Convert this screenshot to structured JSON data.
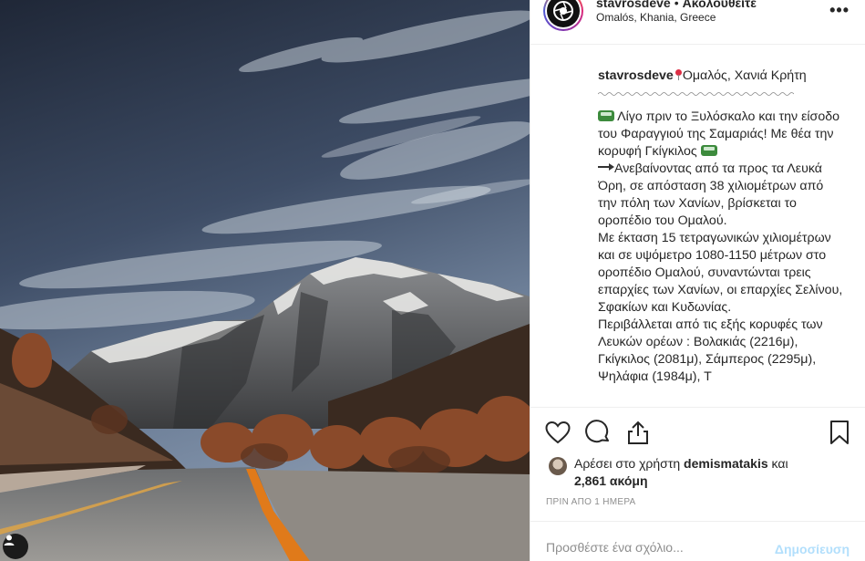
{
  "header": {
    "username": "stavrosdeve",
    "separator": "•",
    "follow_label": "Ακολουθείτε",
    "location": "Omalós, Khania, Greece",
    "more_icon": "more-horizontal-icon"
  },
  "caption": {
    "username": "stavrosdeve",
    "place": "Ομαλός, Χανιά Κρήτη",
    "line1": " Λίγο πριν το Ξυλόσκαλο και την είσοδο του Φαραγγιού της Σαμαριάς! Με θέα την κορυφή Γκίγκιλος ",
    "line2": "Ανεβαίνοντας από τα προς τα Λευκά Όρη, σε απόσταση 38 χιλιομέτρων από την πόλη των Χανίων, βρίσκεται το οροπέδιο του Ομαλού.\nΜε έκταση 15 τετραγωνικών χιλιομέτρων και σε υψόμετρο 1080-1150 μέτρων στο οροπέδιο Ομαλού, συναντώνται τρεις επαρχίες των Χανίων, οι επαρχίες Σελίνου, Σφακίων και Κυδωνίας.\nΠεριβάλλεται από τις εξής κορυφές των Λευκών ορέων : Βολακιάς (2216μ), Γκίγκιλος (2081μ), Σάμπερος (2295μ), Ψηλάφια (1984μ), Τ"
  },
  "actions": {
    "like_icon": "heart-icon",
    "comment_icon": "comment-icon",
    "share_icon": "share-icon",
    "save_icon": "bookmark-icon"
  },
  "likes": {
    "prefix": "Αρέσει στο χρήστη ",
    "liker": "demismatakis",
    "and": " και",
    "count": "2,861 ακόμη"
  },
  "timestamp": "ΠΡΙΝ ΑΠΟ 1 ΗΜΕΡΑ",
  "comment": {
    "placeholder": "Προσθέστε ένα σχόλιο...",
    "post_label": "Δημοσίευση"
  },
  "colors": {
    "text": "#262626",
    "muted": "#8e8e8e",
    "border": "#efefef",
    "post_disabled": "#b2dffc"
  }
}
